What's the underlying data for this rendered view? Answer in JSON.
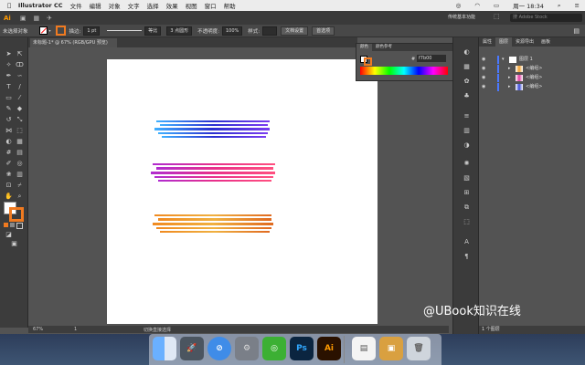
{
  "menubar": {
    "app_name": "Illustrator CC",
    "items": [
      "文件",
      "编辑",
      "对象",
      "文字",
      "选择",
      "效果",
      "视图",
      "窗口",
      "帮助"
    ],
    "time": "周一 18:34"
  },
  "appbar": {
    "workspace": "传统基本功能",
    "search_placeholder": "搜 Adobe Stock"
  },
  "control": {
    "selection_label": "未选择对象",
    "stroke_label": "描边:",
    "stroke_value": "1 pt",
    "profile": "等比",
    "brush": "3 点圆形",
    "opacity_label": "不透明度:",
    "opacity_value": "100%",
    "style_label": "样式:",
    "doc_setup_button": "文档设置",
    "prefs_button": "首选项"
  },
  "document": {
    "tab_title": "未标题-1* @ 67% (RGB/GPU 预览)"
  },
  "color_panel": {
    "tab_color": "颜色",
    "tab_color_guide": "颜色参考",
    "hex_value": "f7b00"
  },
  "layers_panel": {
    "tabs": [
      "属性",
      "图层",
      "资源导出",
      "画板"
    ],
    "layer_name": "图层 1",
    "sublayers": [
      "<编组>",
      "<编组>",
      "<编组>"
    ],
    "footer": "1 个图层"
  },
  "status": {
    "zoom": "67%",
    "page": "1",
    "tool_hint": "切换直接选择"
  },
  "dock": {
    "icons": [
      "finder-icon",
      "launchpad-icon",
      "safari-icon",
      "system-prefs-icon",
      "wechat-icon",
      "photoshop-icon",
      "illustrator-icon",
      "document-icon",
      "preview-icon",
      "trash-icon"
    ],
    "ps_label": "Ps",
    "ai_label": "Ai"
  },
  "watermark": "@UBook知识在线",
  "colors": {
    "stroke1": "#3a49d6",
    "stroke2": "#e03aa0",
    "stroke3": "#f0a030"
  }
}
